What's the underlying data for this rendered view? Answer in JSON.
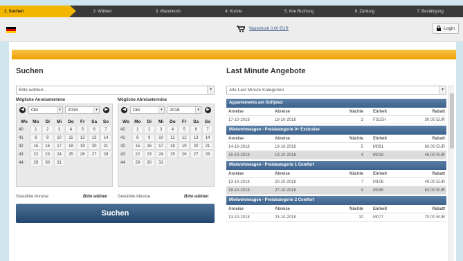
{
  "steps": [
    "1. Suchen",
    "2. Wählen",
    "3. Warenkorb",
    "4. Kunde",
    "5. Ihre Buchung",
    "6. Zahlung",
    "7. Bestätigung"
  ],
  "header": {
    "cart_text": "Warenkorb 0,00 EUR",
    "login_label": "Login"
  },
  "search": {
    "title": "Suchen",
    "select_placeholder": "Bitte wählen...",
    "arrival_label": "Mögliche Anreisetermine",
    "departure_label": "Mögliche Abreisetermine",
    "month": "Okt",
    "year": "2018",
    "weekday_headers": [
      "Wo",
      "Mo",
      "Di",
      "Mi",
      "Do",
      "Fr",
      "Sa",
      "So"
    ],
    "weeks": [
      [
        "40",
        "1",
        "2",
        "3",
        "4",
        "5",
        "6",
        "7"
      ],
      [
        "41",
        "8",
        "9",
        "10",
        "11",
        "12",
        "13",
        "14"
      ],
      [
        "42",
        "15",
        "16",
        "17",
        "18",
        "19",
        "20",
        "21"
      ],
      [
        "43",
        "22",
        "23",
        "24",
        "25",
        "26",
        "27",
        "28"
      ],
      [
        "44",
        "29",
        "30",
        "31",
        "",
        "",
        "",
        ""
      ]
    ],
    "selected_arrival_label": "Gewählte Anreise",
    "selected_departure_label": "Gewählte Abreise",
    "choose_text": "Bitte wählen",
    "button_label": "Suchen"
  },
  "last_minute": {
    "title": "Last Minute Angebote",
    "filter": "Alle Last Minute Kategorien",
    "columns": [
      "Anreise",
      "Abreise",
      "Nächte",
      "Einheit",
      "Rabatt"
    ],
    "categories": [
      {
        "name": "Appartements am Golfplatz",
        "rows": [
          [
            "17-10-2018",
            "19-10-2018",
            "2",
            "F31EH",
            "30.00 EUR"
          ]
        ]
      },
      {
        "name": "Mietwohnwagen - Preiskategorie 0+ Exclusive",
        "rows": [
          [
            "14-10-2018",
            "19-10-2018",
            "5",
            "M091",
            "60.00 EUR"
          ],
          [
            "15-10-2018",
            "19-10-2018",
            "4",
            "M019",
            "48.00 EUR"
          ]
        ]
      },
      {
        "name": "Mietwohnwagen - Preiskategorie 1 Comfort",
        "rows": [
          [
            "13-10-2018",
            "20-10-2018",
            "7",
            "M108",
            "49.00 EUR"
          ],
          [
            "18-10-2018",
            "27-10-2018",
            "9",
            "M045",
            "63.00 EUR"
          ]
        ]
      },
      {
        "name": "Mietwohnwagen - Preiskategorie 2 Comfort",
        "rows": [
          [
            "13-10-2018",
            "23-10-2018",
            "10",
            "M077",
            "70.00 EUR"
          ]
        ]
      }
    ]
  },
  "colors": {
    "accent": "#f2b600",
    "header_bar": "#3c628c",
    "button": "#2b4f75"
  }
}
